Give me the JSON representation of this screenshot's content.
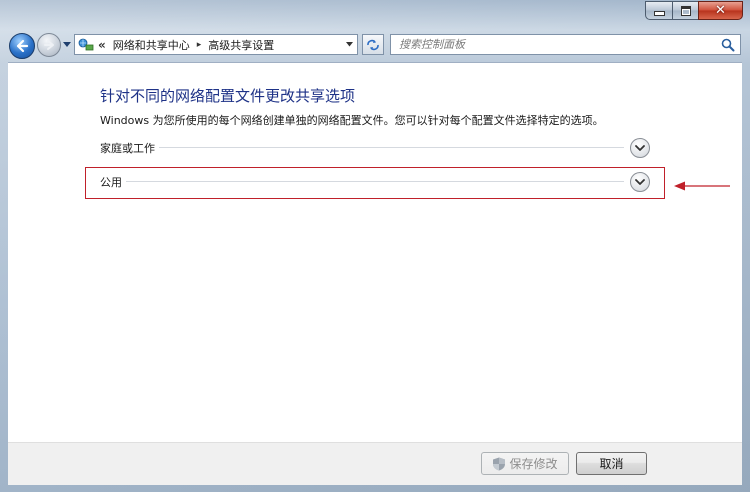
{
  "window": {
    "caption": {
      "minimize": "minimize-icon",
      "maximize": "maximize-icon",
      "close": "close-icon"
    }
  },
  "address_bar": {
    "overflow": "«",
    "crumbs": [
      "网络和共享中心",
      "高级共享设置"
    ],
    "separator": "▸"
  },
  "search": {
    "placeholder": "搜索控制面板"
  },
  "main": {
    "title": "针对不同的网络配置文件更改共享选项",
    "description": "Windows 为您所使用的每个网络创建单独的网络配置文件。您可以针对每个配置文件选择特定的选项。",
    "profiles": [
      {
        "label": "家庭或工作",
        "expanded": false
      },
      {
        "label": "公用",
        "expanded": false,
        "highlighted": true
      }
    ]
  },
  "buttons": {
    "save": "保存修改",
    "cancel": "取消"
  },
  "colors": {
    "title_blue": "#1e3287",
    "highlight_red": "#c0202a"
  }
}
